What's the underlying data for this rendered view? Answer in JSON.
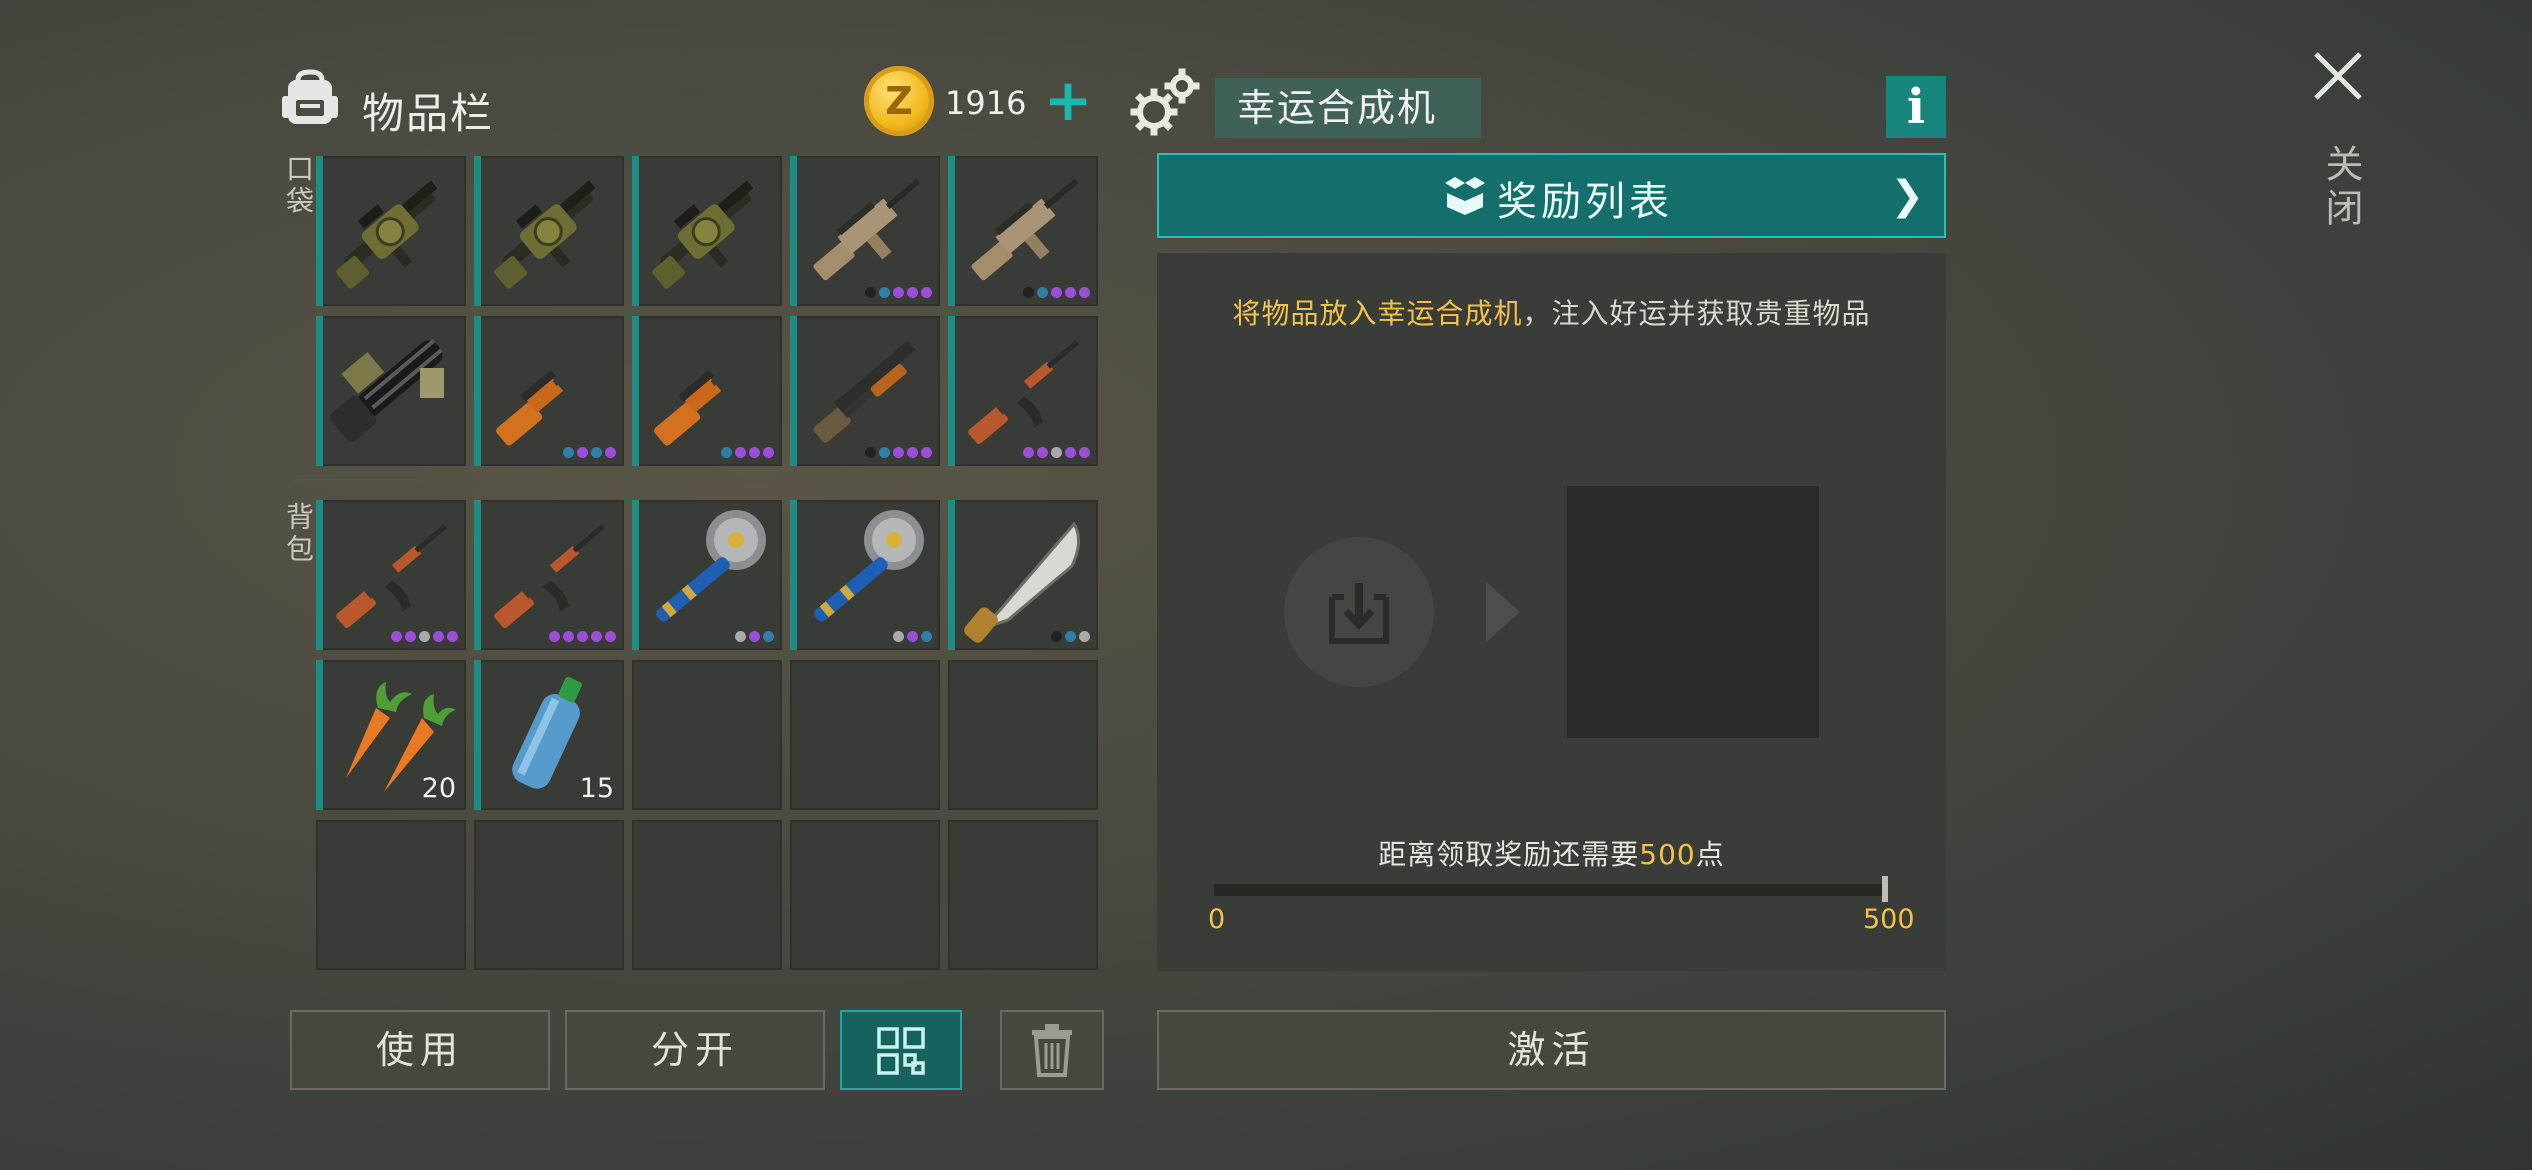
{
  "inventory": {
    "title": "物品栏",
    "coin_icon": "Z",
    "coins": "1916",
    "add_icon": "+",
    "section_pocket": "口袋",
    "section_backpack": "背包"
  },
  "pocket_slots": [
    {
      "item": "grenade-launcher",
      "dots": []
    },
    {
      "item": "grenade-launcher",
      "dots": []
    },
    {
      "item": "grenade-launcher",
      "dots": []
    },
    {
      "item": "scar-rifle",
      "dots": [
        "#222",
        "#2f7fa6",
        "#9a4fd6",
        "#9a4fd6",
        "#9a4fd6"
      ]
    },
    {
      "item": "scar-rifle",
      "dots": [
        "#222",
        "#2f7fa6",
        "#9a4fd6",
        "#9a4fd6",
        "#9a4fd6"
      ]
    },
    {
      "item": "minigun",
      "dots": []
    },
    {
      "item": "hunting-rifle",
      "dots": [
        "#2f7fa6",
        "#9a4fd6",
        "#2f7fa6",
        "#9a4fd6"
      ]
    },
    {
      "item": "hunting-rifle",
      "dots": [
        "#2f7fa6",
        "#9a4fd6",
        "#9a4fd6",
        "#9a4fd6"
      ]
    },
    {
      "item": "pump-shotgun",
      "dots": [
        "#222",
        "#2f7fa6",
        "#9a4fd6",
        "#9a4fd6",
        "#9a4fd6"
      ]
    },
    {
      "item": "ak-rifle",
      "dots": [
        "#9a4fd6",
        "#9a4fd6",
        "#aaaaaa",
        "#9a4fd6",
        "#9a4fd6"
      ]
    }
  ],
  "backpack_slots": [
    {
      "item": "ak-rifle",
      "dots": [
        "#9a4fd6",
        "#9a4fd6",
        "#aaaaaa",
        "#9a4fd6",
        "#9a4fd6"
      ]
    },
    {
      "item": "ak-rifle",
      "dots": [
        "#9a4fd6",
        "#9a4fd6",
        "#9a4fd6",
        "#9a4fd6",
        "#9a4fd6"
      ]
    },
    {
      "item": "saw-mace",
      "dots": [
        "#aaaaaa",
        "#9a4fd6",
        "#2f7fa6"
      ]
    },
    {
      "item": "saw-mace",
      "dots": [
        "#aaaaaa",
        "#9a4fd6",
        "#2f7fa6"
      ]
    },
    {
      "item": "machete",
      "dots": [
        "#222",
        "#2f7fa6",
        "#aaaaaa"
      ]
    },
    {
      "item": "carrots",
      "qty": "20"
    },
    {
      "item": "water-bottle",
      "qty": "15"
    },
    {
      "item": ""
    },
    {
      "item": ""
    },
    {
      "item": ""
    },
    {
      "item": ""
    },
    {
      "item": ""
    },
    {
      "item": ""
    },
    {
      "item": ""
    },
    {
      "item": ""
    }
  ],
  "buttons": {
    "use": "使用",
    "split": "分开",
    "activate": "激活"
  },
  "machine": {
    "title": "幸运合成机",
    "info_icon": "i",
    "reward_list": "奖励列表",
    "hint_highlight": "将物品放入幸运合成机",
    "hint_rest": "，注入好运并获取贵重物品",
    "progress_prefix": "距离领取奖励还需要",
    "progress_points": "500",
    "progress_suffix": "点",
    "range_min": "0",
    "range_max": "500",
    "progress_fraction": 0
  },
  "close_label": "关闭",
  "colors": {
    "accent": "#1fb7ad",
    "highlight": "#f3c24a",
    "rarity_purple": "#9a4fd6",
    "rarity_blue": "#2f7fa6"
  }
}
